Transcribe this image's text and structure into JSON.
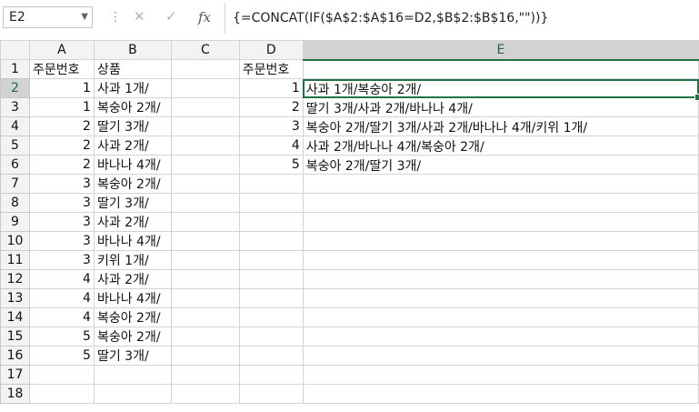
{
  "name_box": "E2",
  "formula": "{=CONCAT(IF($A$2:$A$16=D2,$B$2:$B$16,\"\"))}",
  "icons": {
    "cancel": "✕",
    "enter": "✓",
    "fx": "fx",
    "dropdown": "▼",
    "separator": "⋮"
  },
  "columns": [
    "A",
    "B",
    "C",
    "D",
    "E"
  ],
  "rows": [
    {
      "n": "1",
      "a": "주문번호",
      "b": "상품",
      "c": "",
      "d": "주문번호",
      "e": ""
    },
    {
      "n": "2",
      "a": "1",
      "b": "사과 1개/",
      "c": "",
      "d": "1",
      "e": "사과 1개/복숭아 2개/"
    },
    {
      "n": "3",
      "a": "1",
      "b": "복숭아 2개/",
      "c": "",
      "d": "2",
      "e": "딸기 3개/사과 2개/바나나 4개/"
    },
    {
      "n": "4",
      "a": "2",
      "b": "딸기 3개/",
      "c": "",
      "d": "3",
      "e": "복숭아 2개/딸기 3개/사과 2개/바나나 4개/키위 1개/"
    },
    {
      "n": "5",
      "a": "2",
      "b": "사과 2개/",
      "c": "",
      "d": "4",
      "e": "사과 2개/바나나 4개/복숭아 2개/"
    },
    {
      "n": "6",
      "a": "2",
      "b": "바나나 4개/",
      "c": "",
      "d": "5",
      "e": "복숭아 2개/딸기 3개/"
    },
    {
      "n": "7",
      "a": "3",
      "b": "복숭아 2개/",
      "c": "",
      "d": "",
      "e": ""
    },
    {
      "n": "8",
      "a": "3",
      "b": "딸기 3개/",
      "c": "",
      "d": "",
      "e": ""
    },
    {
      "n": "9",
      "a": "3",
      "b": "사과 2개/",
      "c": "",
      "d": "",
      "e": ""
    },
    {
      "n": "10",
      "a": "3",
      "b": "바나나 4개/",
      "c": "",
      "d": "",
      "e": ""
    },
    {
      "n": "11",
      "a": "3",
      "b": "키위 1개/",
      "c": "",
      "d": "",
      "e": ""
    },
    {
      "n": "12",
      "a": "4",
      "b": "사과 2개/",
      "c": "",
      "d": "",
      "e": ""
    },
    {
      "n": "13",
      "a": "4",
      "b": "바나나 4개/",
      "c": "",
      "d": "",
      "e": ""
    },
    {
      "n": "14",
      "a": "4",
      "b": "복숭아 2개/",
      "c": "",
      "d": "",
      "e": ""
    },
    {
      "n": "15",
      "a": "5",
      "b": "복숭아 2개/",
      "c": "",
      "d": "",
      "e": ""
    },
    {
      "n": "16",
      "a": "5",
      "b": "딸기 3개/",
      "c": "",
      "d": "",
      "e": ""
    },
    {
      "n": "17",
      "a": "",
      "b": "",
      "c": "",
      "d": "",
      "e": ""
    },
    {
      "n": "18",
      "a": "",
      "b": "",
      "c": "",
      "d": "",
      "e": ""
    }
  ]
}
